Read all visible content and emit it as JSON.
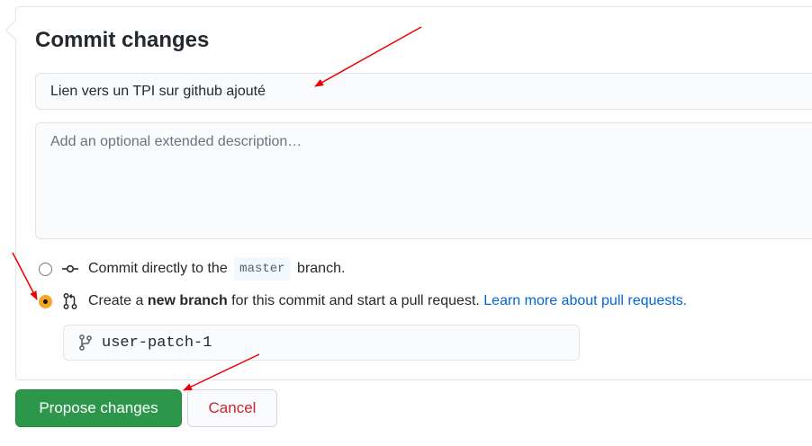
{
  "commit_form": {
    "title": "Commit changes",
    "summary_value": "Lien vers un TPI sur github ajouté",
    "description_placeholder": "Add an optional extended description…",
    "options": {
      "direct": {
        "before": "Commit directly to the",
        "branch": "master",
        "after": "branch.",
        "selected": false
      },
      "new_branch": {
        "prefix": "Create a ",
        "bold": "new branch",
        "suffix": " for this commit and start a pull request. ",
        "link": "Learn more about pull requests.",
        "selected": true
      }
    },
    "new_branch_name": "user-patch-1"
  },
  "buttons": {
    "propose": "Propose changes",
    "cancel": "Cancel"
  },
  "icons": {
    "direct_commit": "git-commit-icon",
    "pull_request": "git-pull-request-icon",
    "branch": "git-branch-icon"
  },
  "colors": {
    "primary_button": "#2c974b",
    "cancel_text": "#cb2431",
    "link": "#0366d6",
    "annotation_arrow": "#ee0000",
    "radio_selected": "#f5a623"
  }
}
